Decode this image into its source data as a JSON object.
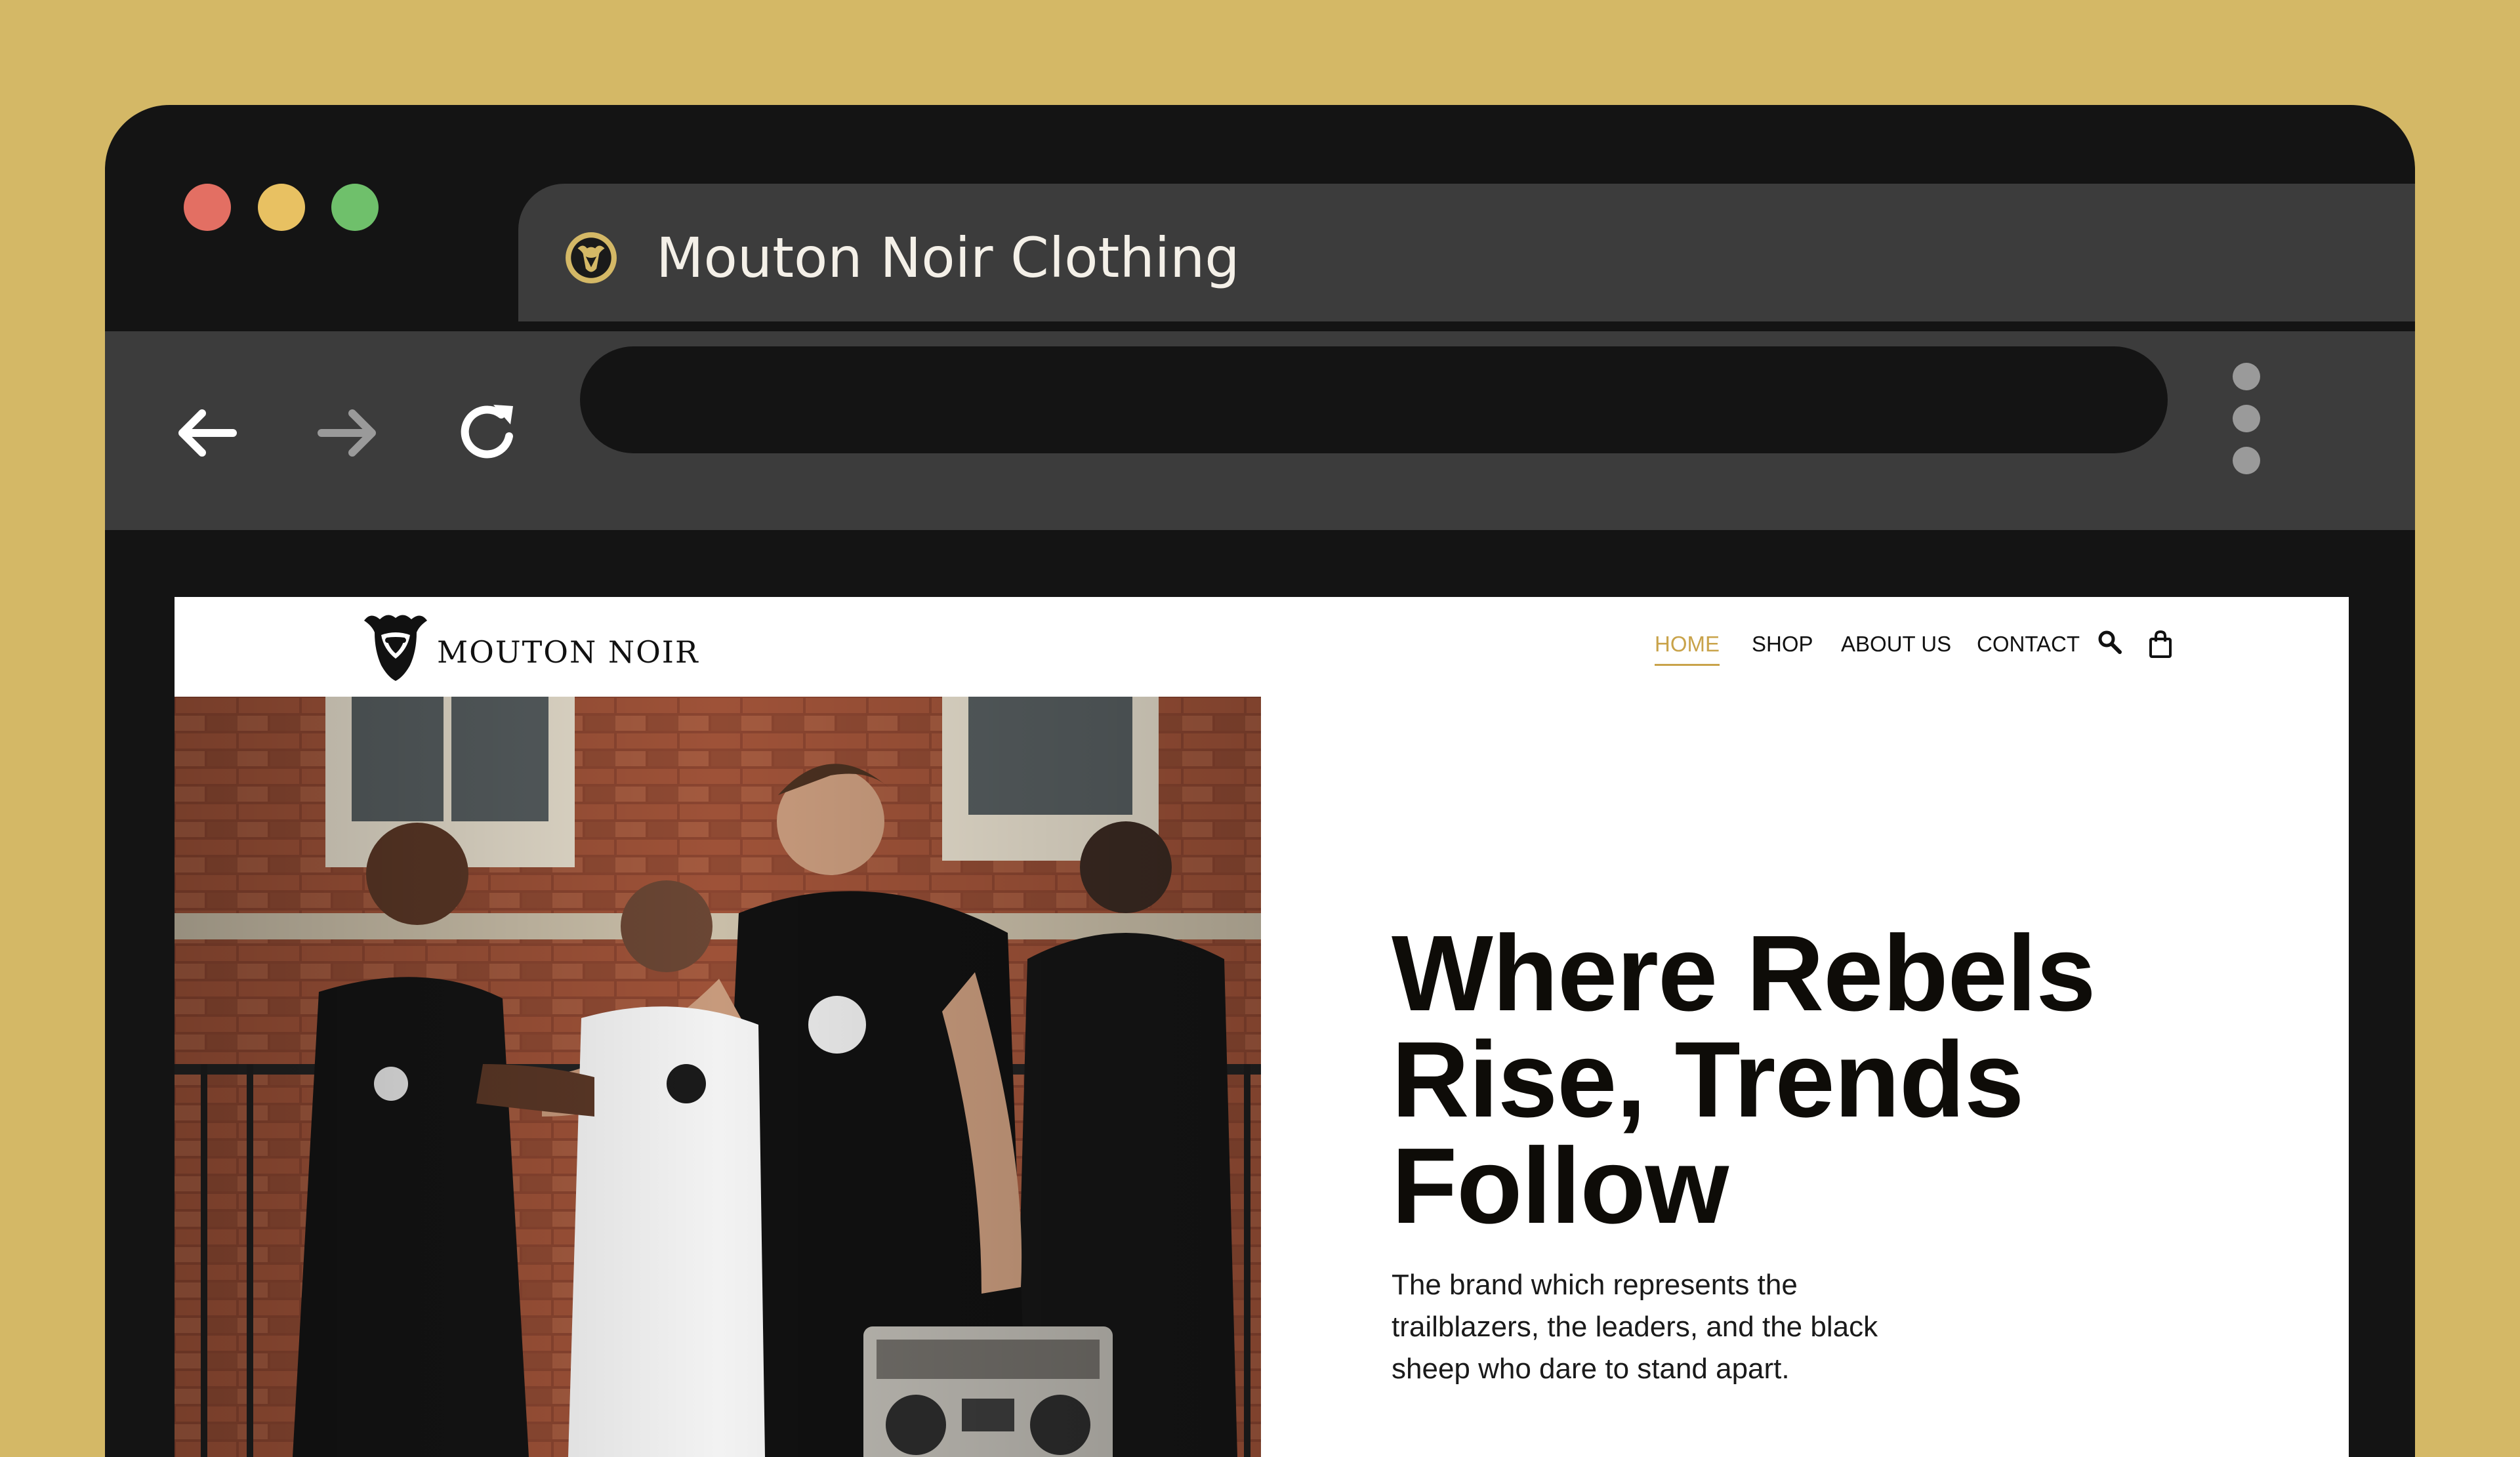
{
  "colors": {
    "page_background": "#D4B866",
    "window_frame": "#141414",
    "toolbar": "#3C3C3C",
    "traffic_red": "#E36F63",
    "traffic_yellow": "#E8C162",
    "traffic_green": "#6FC06B",
    "accent_gold": "#C9A34A"
  },
  "browser": {
    "tab": {
      "favicon": "sheep-head-icon",
      "title": "Mouton Noir Clothing"
    },
    "address_bar": {
      "value": ""
    },
    "icons": {
      "back": "arrow-left-icon",
      "forward": "arrow-right-icon",
      "reload": "reload-icon",
      "menu": "kebab-menu-icon"
    }
  },
  "site": {
    "logo": {
      "icon": "sheep-head-icon",
      "text": "MOUTON NOIR"
    },
    "nav": {
      "items": [
        {
          "label": "HOME",
          "active": true
        },
        {
          "label": "SHOP",
          "active": false
        },
        {
          "label": "ABOUT US",
          "active": false
        },
        {
          "label": "CONTACT",
          "active": false
        }
      ],
      "search_icon": "search-icon",
      "cart_icon": "shopping-bag-icon"
    },
    "hero": {
      "photo": "group-of-young-men-in-branded-tshirts",
      "title_lines": [
        "Where Rebels",
        "Rise, Trends",
        "Follow"
      ],
      "subtitle": "The brand which represents the trailblazers, the leaders, and the black sheep who dare to stand apart."
    }
  }
}
